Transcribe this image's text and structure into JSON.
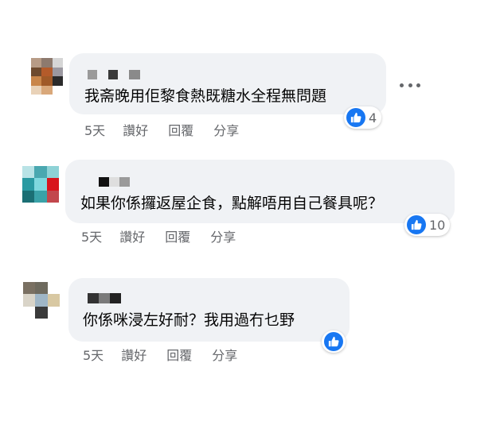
{
  "comments": [
    {
      "text": "我斋晚用佢黎食熱既糖水全程無問題",
      "reaction_count": "4",
      "actions": {
        "time": "5天",
        "like": "讚好",
        "reply": "回覆",
        "share": "分享"
      }
    },
    {
      "text": "如果你係攞返屋企食，點解唔用自己餐具呢？",
      "reaction_count": "10",
      "actions": {
        "time": "5天",
        "like": "讚好",
        "reply": "回覆",
        "share": "分享"
      }
    },
    {
      "text": "你係咪浸左好耐？我用過冇乜野",
      "reaction_count": "",
      "actions": {
        "time": "5天",
        "like": "讚好",
        "reply": "回覆",
        "share": "分享"
      }
    }
  ],
  "icons": {
    "reaction": "like-thumb-icon",
    "options": "more-options-icon"
  },
  "colors": {
    "like_blue": "#1877f2",
    "bubble_bg": "#f0f2f5",
    "meta_gray": "#65676b"
  }
}
